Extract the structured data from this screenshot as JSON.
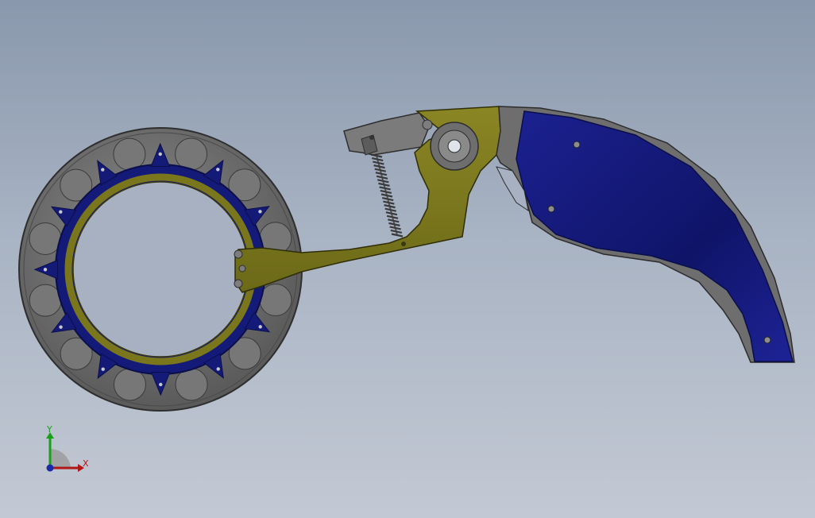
{
  "viewport": {
    "background_top": "#8a98ad",
    "background_bottom": "#c3c9d4"
  },
  "triad": {
    "x_label": "X",
    "y_label": "Y",
    "x_color": "#b01818",
    "y_color": "#18a018",
    "z_color": "#1a2aa8"
  },
  "colors": {
    "steel": "#6d6d6d",
    "steel_dark": "#3a3a3a",
    "brass": "#7d7a1f",
    "navy": "#13187a"
  }
}
